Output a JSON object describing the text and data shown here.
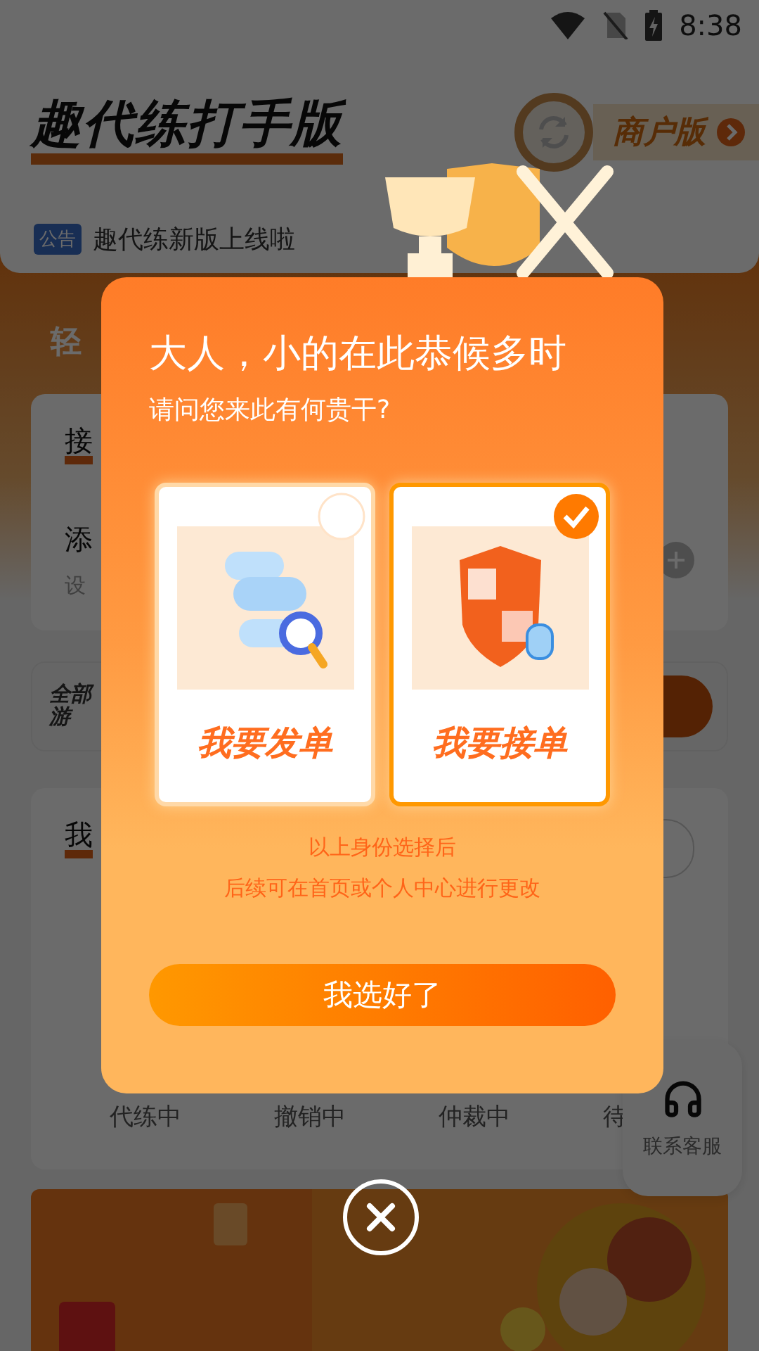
{
  "status_bar": {
    "time": "8:38"
  },
  "header": {
    "title": "趣代练打手版",
    "switch_button": "商户版",
    "notice": {
      "badge": "公告",
      "text": "趣代练新版上线啦"
    }
  },
  "background": {
    "section_title": "轻",
    "card": {
      "title": "接",
      "item_title": "添",
      "item_subtitle": "设"
    },
    "games_label": [
      "全部",
      "游"
    ],
    "orders": {
      "title": "我",
      "tabs": [
        "代练中",
        "撤销中",
        "仲裁中",
        "待"
      ]
    },
    "support_button": "联系客服"
  },
  "dialog": {
    "title": "大人，小的在此恭候多时",
    "subtitle": "请问您来此有何贵干?",
    "options": [
      {
        "kind": "post",
        "label": "我要发单",
        "selected": false
      },
      {
        "kind": "accept",
        "label": "我要接单",
        "selected": true
      }
    ],
    "note": [
      "以上身份选择后",
      "后续可在首页或个人中心进行更改"
    ],
    "confirm_button": "我选好了"
  }
}
